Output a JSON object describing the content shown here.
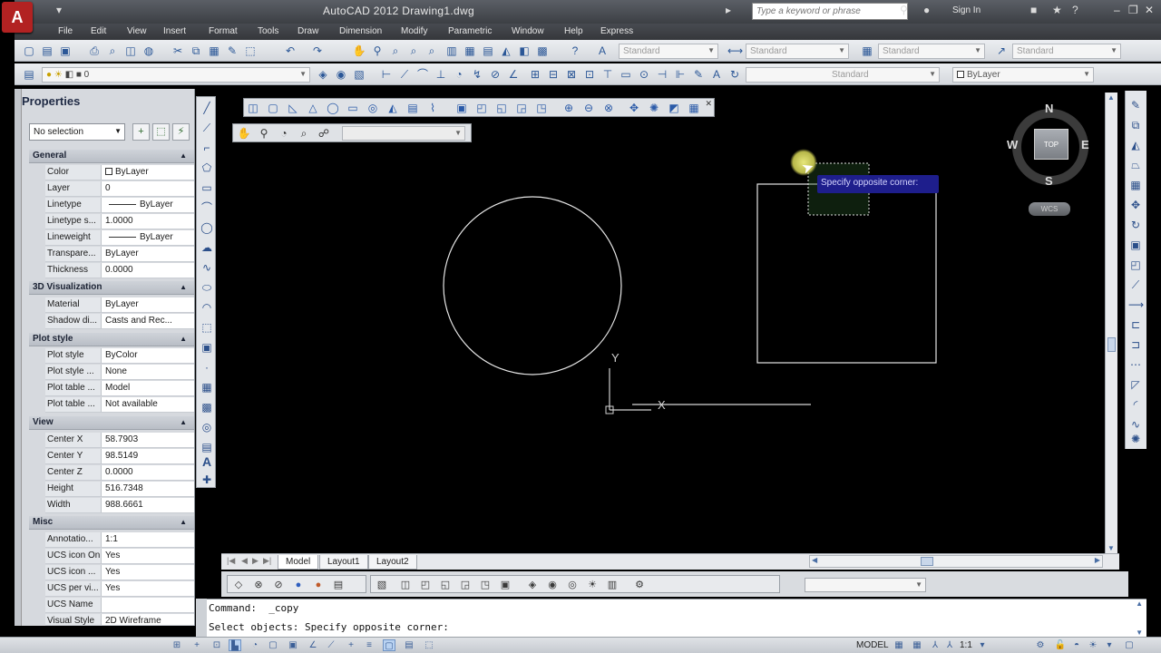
{
  "window": {
    "title": "AutoCAD 2012    Drawing1.dwg",
    "logo_letter": "A",
    "search_placeholder": "Type a keyword or phrase",
    "sign_in": "Sign In"
  },
  "menu": [
    "File",
    "Edit",
    "View",
    "Insert",
    "Format",
    "Tools",
    "Draw",
    "Dimension",
    "Modify",
    "Parametric",
    "Window",
    "Help",
    "Express"
  ],
  "toolbar": {
    "text_style": "Standard",
    "dim_style": "Standard",
    "table_style": "Standard",
    "mleader_style": "Standard",
    "layer_combo": "0",
    "visual_style_combo": "Standard",
    "color_combo": "ByLayer"
  },
  "properties": {
    "title": "Properties",
    "selection": "No selection",
    "sections": {
      "general": {
        "label": "General",
        "rows": [
          {
            "key": "Color",
            "value": "ByLayer"
          },
          {
            "key": "Layer",
            "value": "0"
          },
          {
            "key": "Linetype",
            "value": "ByLayer"
          },
          {
            "key": "Linetype s...",
            "value": "1.0000"
          },
          {
            "key": "Lineweight",
            "value": "ByLayer"
          },
          {
            "key": "Transpare...",
            "value": "ByLayer"
          },
          {
            "key": "Thickness",
            "value": "0.0000"
          }
        ]
      },
      "viz3d": {
        "label": "3D Visualization",
        "rows": [
          {
            "key": "Material",
            "value": "ByLayer"
          },
          {
            "key": "Shadow di...",
            "value": "Casts and Rec..."
          }
        ]
      },
      "plot": {
        "label": "Plot style",
        "rows": [
          {
            "key": "Plot style",
            "value": "ByColor"
          },
          {
            "key": "Plot style ...",
            "value": "None"
          },
          {
            "key": "Plot table ...",
            "value": "Model"
          },
          {
            "key": "Plot table ...",
            "value": "Not available"
          }
        ]
      },
      "view": {
        "label": "View",
        "rows": [
          {
            "key": "Center X",
            "value": "58.7903"
          },
          {
            "key": "Center Y",
            "value": "98.5149"
          },
          {
            "key": "Center Z",
            "value": "0.0000"
          },
          {
            "key": "Height",
            "value": "516.7348"
          },
          {
            "key": "Width",
            "value": "988.6661"
          }
        ]
      },
      "misc": {
        "label": "Misc",
        "rows": [
          {
            "key": "Annotatio...",
            "value": "1:1"
          },
          {
            "key": "UCS icon On",
            "value": "Yes"
          },
          {
            "key": "UCS icon ...",
            "value": "Yes"
          },
          {
            "key": "UCS per vi...",
            "value": "Yes"
          },
          {
            "key": "UCS Name",
            "value": ""
          },
          {
            "key": "Visual Style",
            "value": "2D Wireframe"
          }
        ]
      }
    }
  },
  "canvas": {
    "tooltip": "Specify opposite corner:",
    "ucs_x": "X",
    "ucs_y": "Y",
    "viewcube": {
      "face": "TOP",
      "n": "N",
      "s": "S",
      "e": "E",
      "w": "W",
      "wcs": "WCS"
    }
  },
  "tabs": [
    "Model",
    "Layout1",
    "Layout2"
  ],
  "command": {
    "line1": "Command:  _copy",
    "line2": "Select objects: Specify opposite corner:"
  },
  "status": {
    "model": "MODEL",
    "scale": "1:1"
  }
}
